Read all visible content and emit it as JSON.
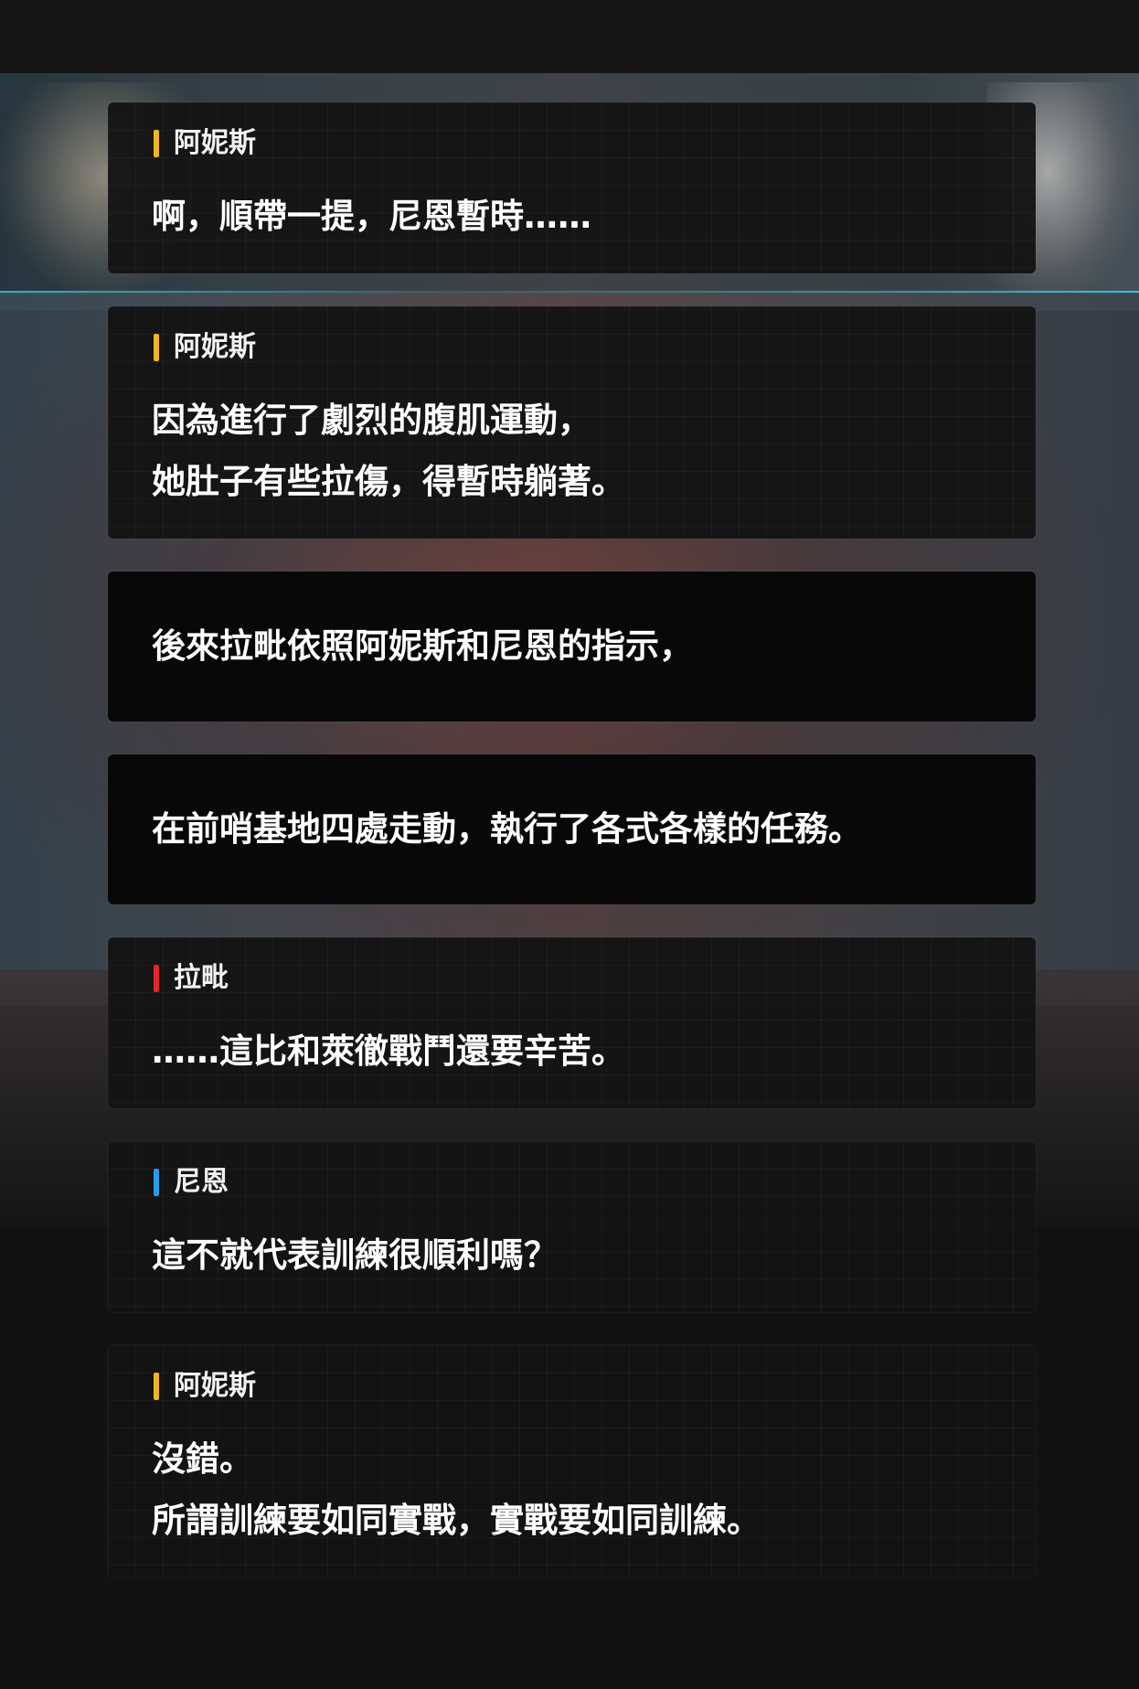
{
  "speaker_colors": {
    "阿妮斯": "#f3b51c",
    "拉毗": "#e8242b",
    "尼恩": "#2a9bea"
  },
  "dialogue": [
    {
      "speaker": "阿妮斯",
      "speaker_color": "#f3b51c",
      "lines": [
        "啊，順帶一提，尼恩暫時……"
      ]
    },
    {
      "speaker": "阿妮斯",
      "speaker_color": "#f3b51c",
      "lines": [
        "因為進行了劇烈的腹肌運動，",
        "她肚子有些拉傷，得暫時躺著。"
      ]
    },
    {
      "speaker": "",
      "lines": [
        "後來拉毗依照阿妮斯和尼恩的指示，"
      ]
    },
    {
      "speaker": "",
      "lines": [
        "在前哨基地四處走動，執行了各式各樣的任務。"
      ]
    },
    {
      "speaker": "拉毗",
      "speaker_color": "#e8242b",
      "lines": [
        "……這比和萊徹戰鬥還要辛苦。"
      ]
    },
    {
      "speaker": "尼恩",
      "speaker_color": "#2a9bea",
      "lines": [
        "這不就代表訓練很順利嗎？"
      ]
    },
    {
      "speaker": "阿妮斯",
      "speaker_color": "#f3b51c",
      "lines": [
        "沒錯。",
        "所謂訓練要如同實戰，實戰要如同訓練。"
      ]
    }
  ]
}
